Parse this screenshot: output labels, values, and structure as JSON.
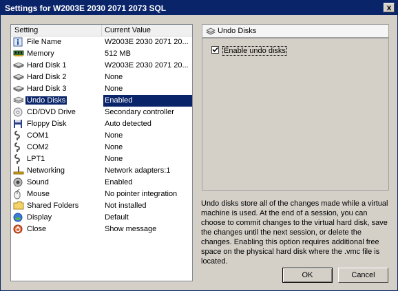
{
  "window": {
    "title": "Settings for W2003E 2030 2071 2073 SQL",
    "close_label": "x"
  },
  "list": {
    "header": {
      "setting": "Setting",
      "value": "Current Value"
    },
    "rows": [
      {
        "name": "File Name",
        "value": "W2003E 2030 2071 20...",
        "icon": "info-icon"
      },
      {
        "name": "Memory",
        "value": "512 MB",
        "icon": "memory-icon"
      },
      {
        "name": "Hard Disk 1",
        "value": "W2003E 2030 2071 20...",
        "icon": "hard-disk-icon"
      },
      {
        "name": "Hard Disk 2",
        "value": "None",
        "icon": "hard-disk-icon"
      },
      {
        "name": "Hard Disk 3",
        "value": "None",
        "icon": "hard-disk-icon"
      },
      {
        "name": "Undo Disks",
        "value": "Enabled",
        "icon": "undo-disks-icon",
        "selected": true
      },
      {
        "name": "CD/DVD Drive",
        "value": "Secondary controller",
        "icon": "cd-dvd-icon"
      },
      {
        "name": "Floppy Disk",
        "value": "Auto detected",
        "icon": "floppy-icon"
      },
      {
        "name": "COM1",
        "value": "None",
        "icon": "serial-port-icon"
      },
      {
        "name": "COM2",
        "value": "None",
        "icon": "serial-port-icon"
      },
      {
        "name": "LPT1",
        "value": "None",
        "icon": "parallel-port-icon"
      },
      {
        "name": "Networking",
        "value": "Network adapters:1",
        "icon": "network-icon"
      },
      {
        "name": "Sound",
        "value": "Enabled",
        "icon": "sound-icon"
      },
      {
        "name": "Mouse",
        "value": "No pointer integration",
        "icon": "mouse-icon"
      },
      {
        "name": "Shared Folders",
        "value": "Not installed",
        "icon": "folder-icon"
      },
      {
        "name": "Display",
        "value": "Default",
        "icon": "display-icon"
      },
      {
        "name": "Close",
        "value": "Show message",
        "icon": "close-power-icon"
      }
    ]
  },
  "panel": {
    "title": "Undo Disks",
    "checkbox_label": "Enable undo disks",
    "checkbox_checked": true,
    "description": "Undo disks store all of the changes made while a virtual machine is used. At the end of a session, you can choose to commit changes to the virtual hard disk, save the changes until the next session, or delete the changes. Enabling this option requires additional free space on the physical hard disk where the .vmc file is located."
  },
  "buttons": {
    "ok": "OK",
    "cancel": "Cancel"
  },
  "colors": {
    "titlebar": "#0a246a",
    "selection": "#0a246a",
    "face": "#d4d0c8"
  }
}
